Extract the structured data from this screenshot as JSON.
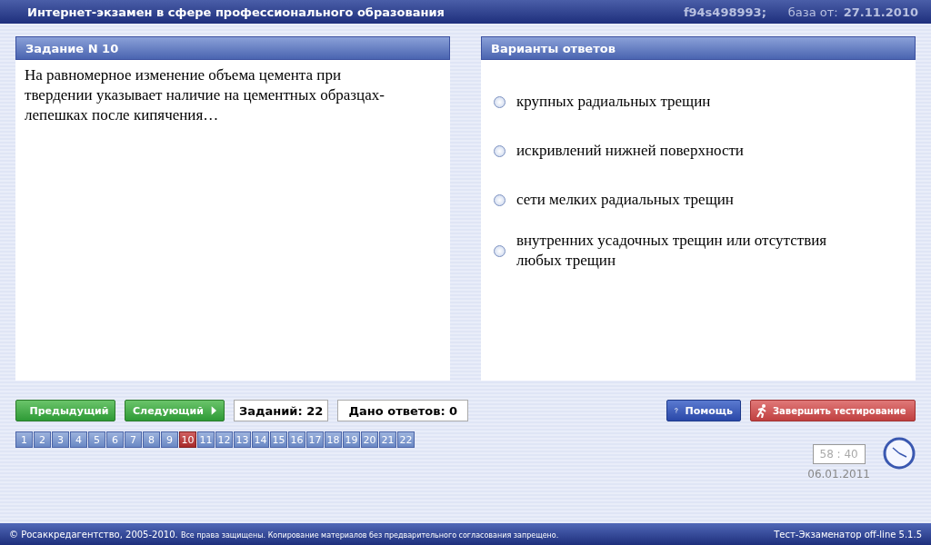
{
  "window": {
    "title": "Интернет-экзамен в сфере профессионального образования",
    "code": "f94s498993;",
    "base_label": "база от:",
    "base_date": "27.11.2010"
  },
  "task": {
    "title": "Задание N 10",
    "text": "На равномерное изменение объема цемента при твердении указывает наличие на цементных образцах-лепешках после кипячения…"
  },
  "answers": {
    "title": "Варианты ответов",
    "options": [
      {
        "text": "крупных радиальных трещин",
        "selected": false
      },
      {
        "text": "искривлений нижней поверхности",
        "selected": false
      },
      {
        "text": "сети мелких радиальных трещин",
        "selected": false
      },
      {
        "text": "внутренних усадочных трещин или отсутствия любых трещин",
        "selected": false
      }
    ]
  },
  "nav": {
    "prev": "Предыдущий",
    "next": "Следующий",
    "total": "Заданий: 22",
    "answered": "Дано ответов: 0",
    "help": "Помощь",
    "finish": "Завершить тестирование"
  },
  "pages": [
    {
      "label": "1",
      "selected": false
    },
    {
      "label": "2",
      "selected": false
    },
    {
      "label": "3",
      "selected": false
    },
    {
      "label": "4",
      "selected": false
    },
    {
      "label": "5",
      "selected": false
    },
    {
      "label": "6",
      "selected": false
    },
    {
      "label": "7",
      "selected": false
    },
    {
      "label": "8",
      "selected": false
    },
    {
      "label": "9",
      "selected": false
    },
    {
      "label": "10",
      "selected": true
    },
    {
      "label": "11",
      "selected": false
    },
    {
      "label": "12",
      "selected": false
    },
    {
      "label": "13",
      "selected": false
    },
    {
      "label": "14",
      "selected": false
    },
    {
      "label": "15",
      "selected": false
    },
    {
      "label": "16",
      "selected": false
    },
    {
      "label": "17",
      "selected": false
    },
    {
      "label": "18",
      "selected": false
    },
    {
      "label": "19",
      "selected": false
    },
    {
      "label": "20",
      "selected": false
    },
    {
      "label": "21",
      "selected": false
    },
    {
      "label": "22",
      "selected": false
    }
  ],
  "timer": {
    "time": "58 : 40",
    "date": "06.01.2011"
  },
  "status_bar": {
    "copyright": "© Росаккредагентство, 2005-2010.",
    "notice": "Все права защищены. Копирование материалов без предварительного согласования запрещено.",
    "version": "Тест-Экзаменатор off-line 5.1.5"
  }
}
